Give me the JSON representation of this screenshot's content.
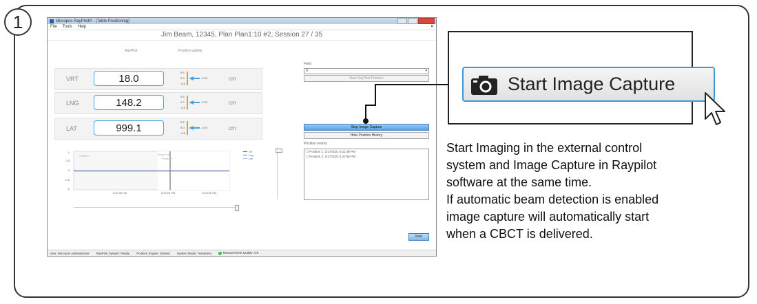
{
  "step_number": "1",
  "app": {
    "window_title": "Micropos RayPilot® - [Table Positioning]",
    "menu": [
      "File",
      "Tools",
      "Help"
    ],
    "close_glyph": "×",
    "session_title": "Jim Beam, 12345, Plan Plan1:10 #2, Session 27 / 35",
    "col_raypilot": "RayPilot",
    "col_validity": "Position validity",
    "readings": [
      {
        "axis": "VRT",
        "value": "18.0",
        "unit": "cm",
        "validity": "-0.03"
      },
      {
        "axis": "LNG",
        "value": "148.2",
        "unit": "cm",
        "validity": "-0.03"
      },
      {
        "axis": "LAT",
        "value": "999.1",
        "unit": "cm",
        "validity": "-0.03"
      }
    ],
    "validity_scale": [
      "0.5",
      "0.0",
      "-0.5"
    ],
    "field_label": "Field",
    "field_value": "0",
    "new_position_button": "New RayPilot Position",
    "stop_capture_button": "Stop Image Capture",
    "hide_history_button": "Hide Position History",
    "events_label": "Position events",
    "events": [
      "Position 1: 2/17/2021 5:21:49 PM",
      "Position 2: 2/17/2021 5:22:56 PM"
    ],
    "chart": {
      "y_ticks": [
        "1",
        "0.5",
        "0",
        "-0.5",
        "-1"
      ],
      "x_ticks": [
        "5:22:30 PM",
        "5:23:00 PM",
        "5:23:30 PM"
      ],
      "annotations": [
        "Position 2",
        "Image Scan",
        "Position 3"
      ],
      "legend": [
        "Vrt",
        "Lng",
        "Lat"
      ]
    },
    "next_button": "Next",
    "status": [
      "User: Micropos Administrator",
      "RayPilot System: Ready",
      "Position Engine: Started",
      "System Mode: Treatment",
      "Measurement Quality: OK"
    ]
  },
  "callout": {
    "button_label": "Start Image Capture",
    "icon": "camera-icon",
    "accent": "#3a9ad9"
  },
  "description_lines": [
    "Start Imaging in the external control",
    "system and Image Capture in Raypilot",
    "software at the same time.",
    "If automatic beam detection is enabled",
    "image capture will automatically start",
    "when a CBCT is delivered."
  ]
}
